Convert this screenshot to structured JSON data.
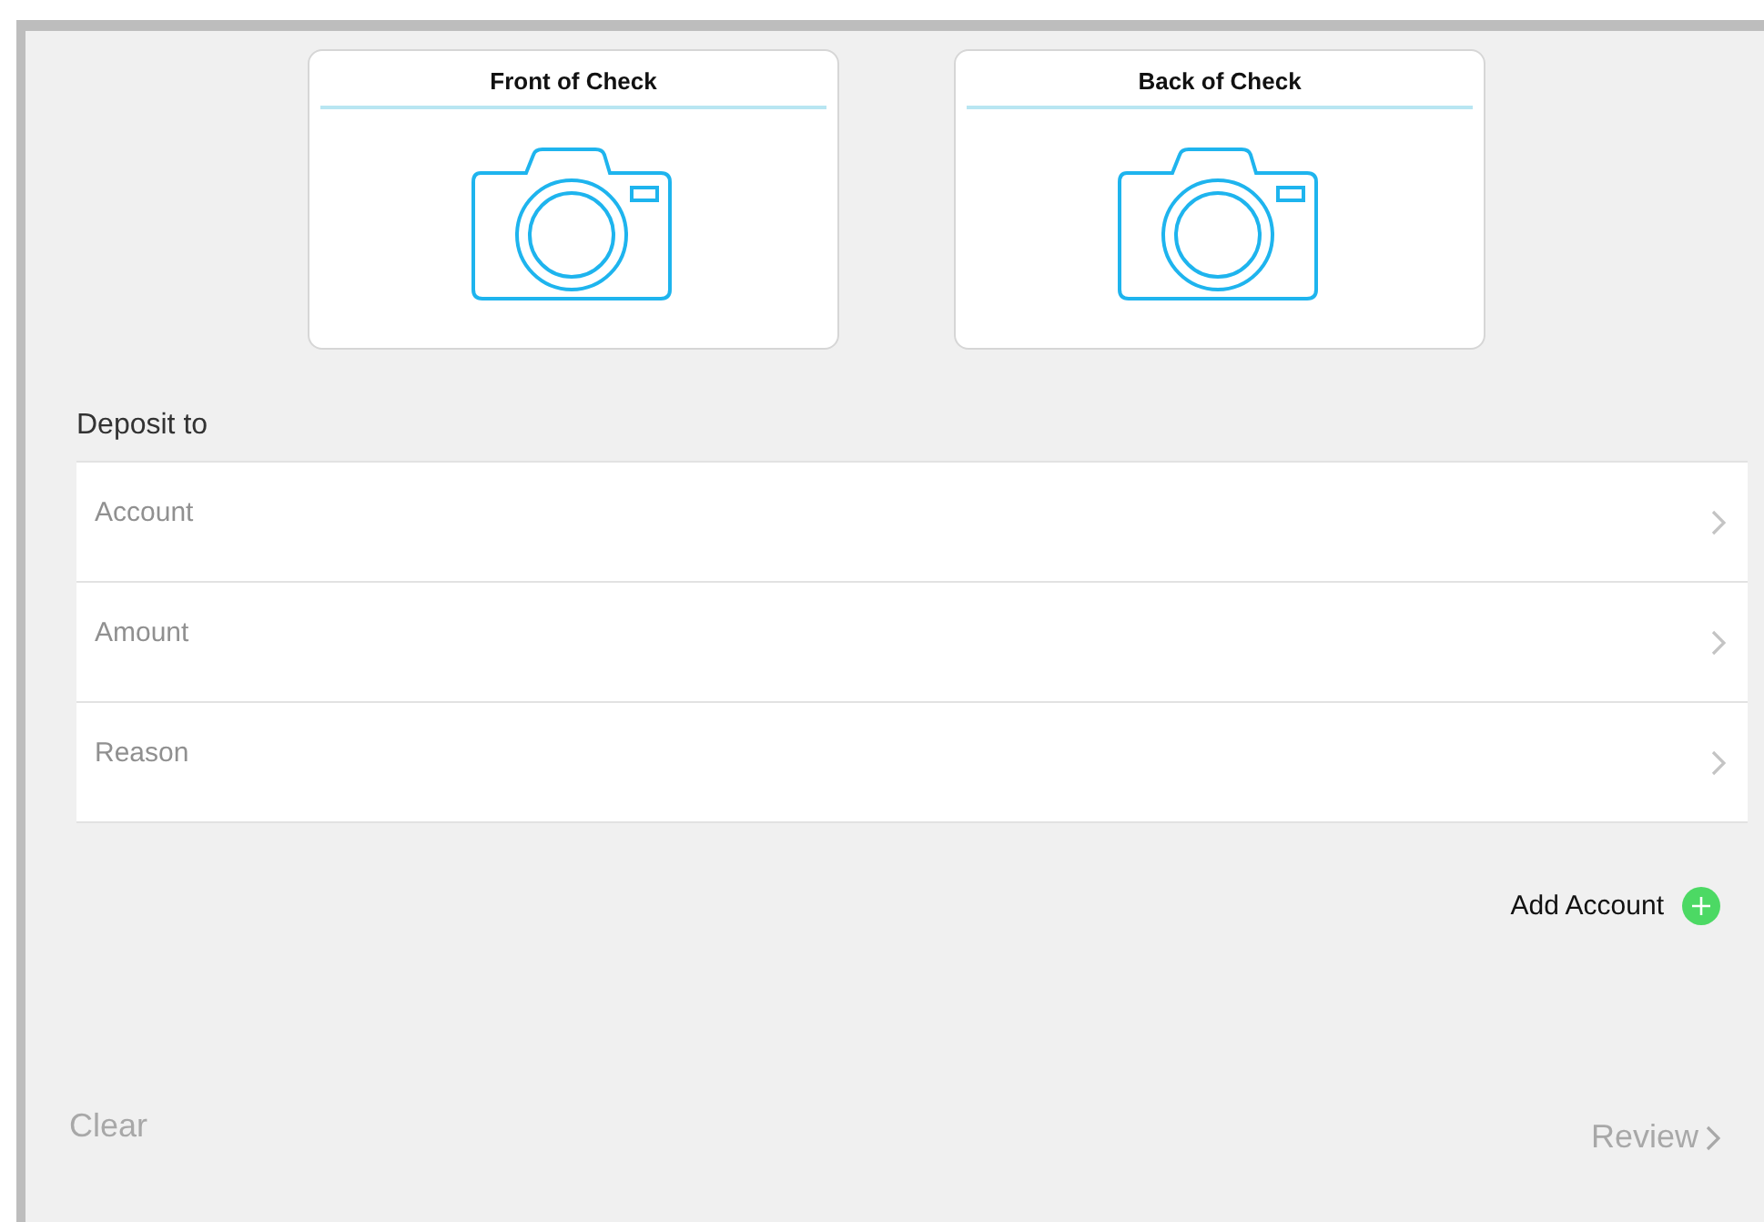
{
  "check_images": [
    {
      "label": "Front of Check"
    },
    {
      "label": "Back of Check"
    }
  ],
  "section_title": "Deposit to",
  "fields": [
    {
      "placeholder": "Account"
    },
    {
      "placeholder": "Amount"
    },
    {
      "placeholder": "Reason"
    }
  ],
  "add_account": {
    "label": "Add Account"
  },
  "footer": {
    "clear": {
      "label": "Clear",
      "disabled": true
    },
    "review": {
      "label": "Review",
      "disabled": true
    }
  }
}
